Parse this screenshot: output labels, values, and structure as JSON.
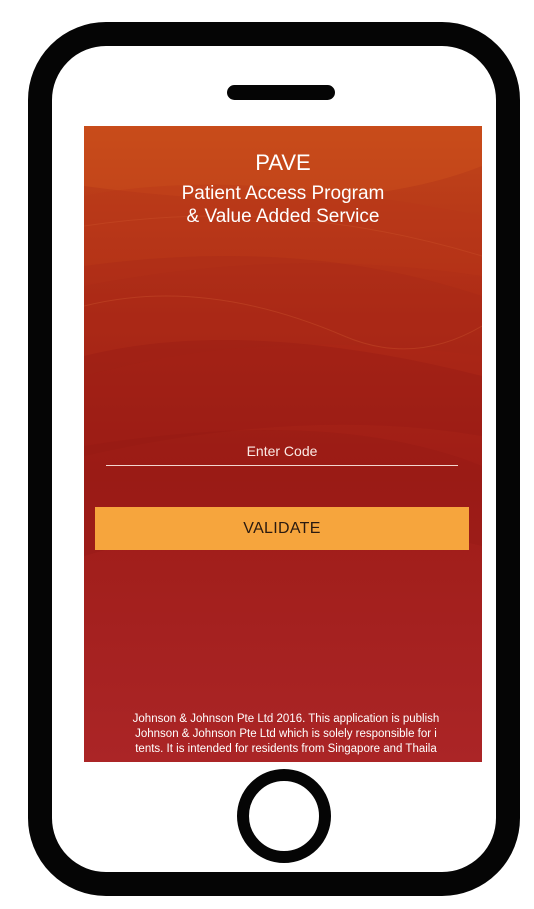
{
  "app": {
    "title": "PAVE",
    "subtitle_line1": "Patient Access Program",
    "subtitle_line2": "& Value Added Service"
  },
  "form": {
    "code_placeholder": "Enter Code",
    "code_value": "",
    "validate_label": "VALIDATE"
  },
  "footer": {
    "line1": "Johnson & Johnson Pte Ltd 2016. This application is publish",
    "line2": "Johnson & Johnson Pte Ltd which is solely responsible for i",
    "line3": "tents. It is intended for residents from Singapore and Thaila"
  },
  "colors": {
    "frame": "#050505",
    "screen_top": "#c2471a",
    "screen_bottom": "#ab2526",
    "button": "#f6a53d",
    "text": "#ffffff"
  },
  "icons": {
    "speaker": "speaker-slot-icon",
    "home": "home-button-icon"
  }
}
